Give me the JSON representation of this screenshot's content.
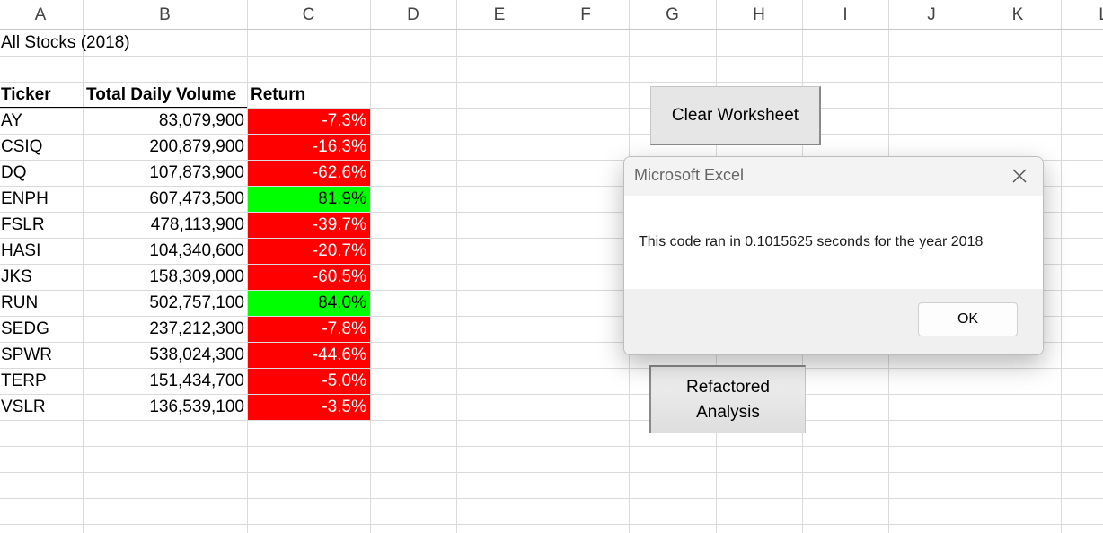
{
  "columns": [
    "A",
    "B",
    "C",
    "D",
    "E",
    "F",
    "G",
    "H",
    "I",
    "J",
    "K",
    "L"
  ],
  "sheet": {
    "title": "All Stocks (2018)",
    "headers": {
      "ticker": "Ticker",
      "volume": "Total Daily Volume",
      "return": "Return"
    },
    "rows": [
      {
        "ticker": "AY",
        "volume": "83,079,900",
        "return": "-7.3%",
        "positive": false
      },
      {
        "ticker": "CSIQ",
        "volume": "200,879,900",
        "return": "-16.3%",
        "positive": false
      },
      {
        "ticker": "DQ",
        "volume": "107,873,900",
        "return": "-62.6%",
        "positive": false
      },
      {
        "ticker": "ENPH",
        "volume": "607,473,500",
        "return": "81.9%",
        "positive": true
      },
      {
        "ticker": "FSLR",
        "volume": "478,113,900",
        "return": "-39.7%",
        "positive": false
      },
      {
        "ticker": "HASI",
        "volume": "104,340,600",
        "return": "-20.7%",
        "positive": false
      },
      {
        "ticker": "JKS",
        "volume": "158,309,000",
        "return": "-60.5%",
        "positive": false
      },
      {
        "ticker": "RUN",
        "volume": "502,757,100",
        "return": "84.0%",
        "positive": true
      },
      {
        "ticker": "SEDG",
        "volume": "237,212,300",
        "return": "-7.8%",
        "positive": false
      },
      {
        "ticker": "SPWR",
        "volume": "538,024,300",
        "return": "-44.6%",
        "positive": false
      },
      {
        "ticker": "TERP",
        "volume": "151,434,700",
        "return": "-5.0%",
        "positive": false
      },
      {
        "ticker": "VSLR",
        "volume": "136,539,100",
        "return": "-3.5%",
        "positive": false
      }
    ]
  },
  "buttons": {
    "clear": "Clear Worksheet",
    "refactor_line1": "Refactored",
    "refactor_line2": "Analysis"
  },
  "dialog": {
    "title": "Microsoft Excel",
    "message": "This code ran in 0.1015625 seconds for the year 2018",
    "ok": "OK",
    "close_icon": "close-icon"
  },
  "colors": {
    "negative_fill": "#ff0000",
    "positive_fill": "#00ff00"
  }
}
